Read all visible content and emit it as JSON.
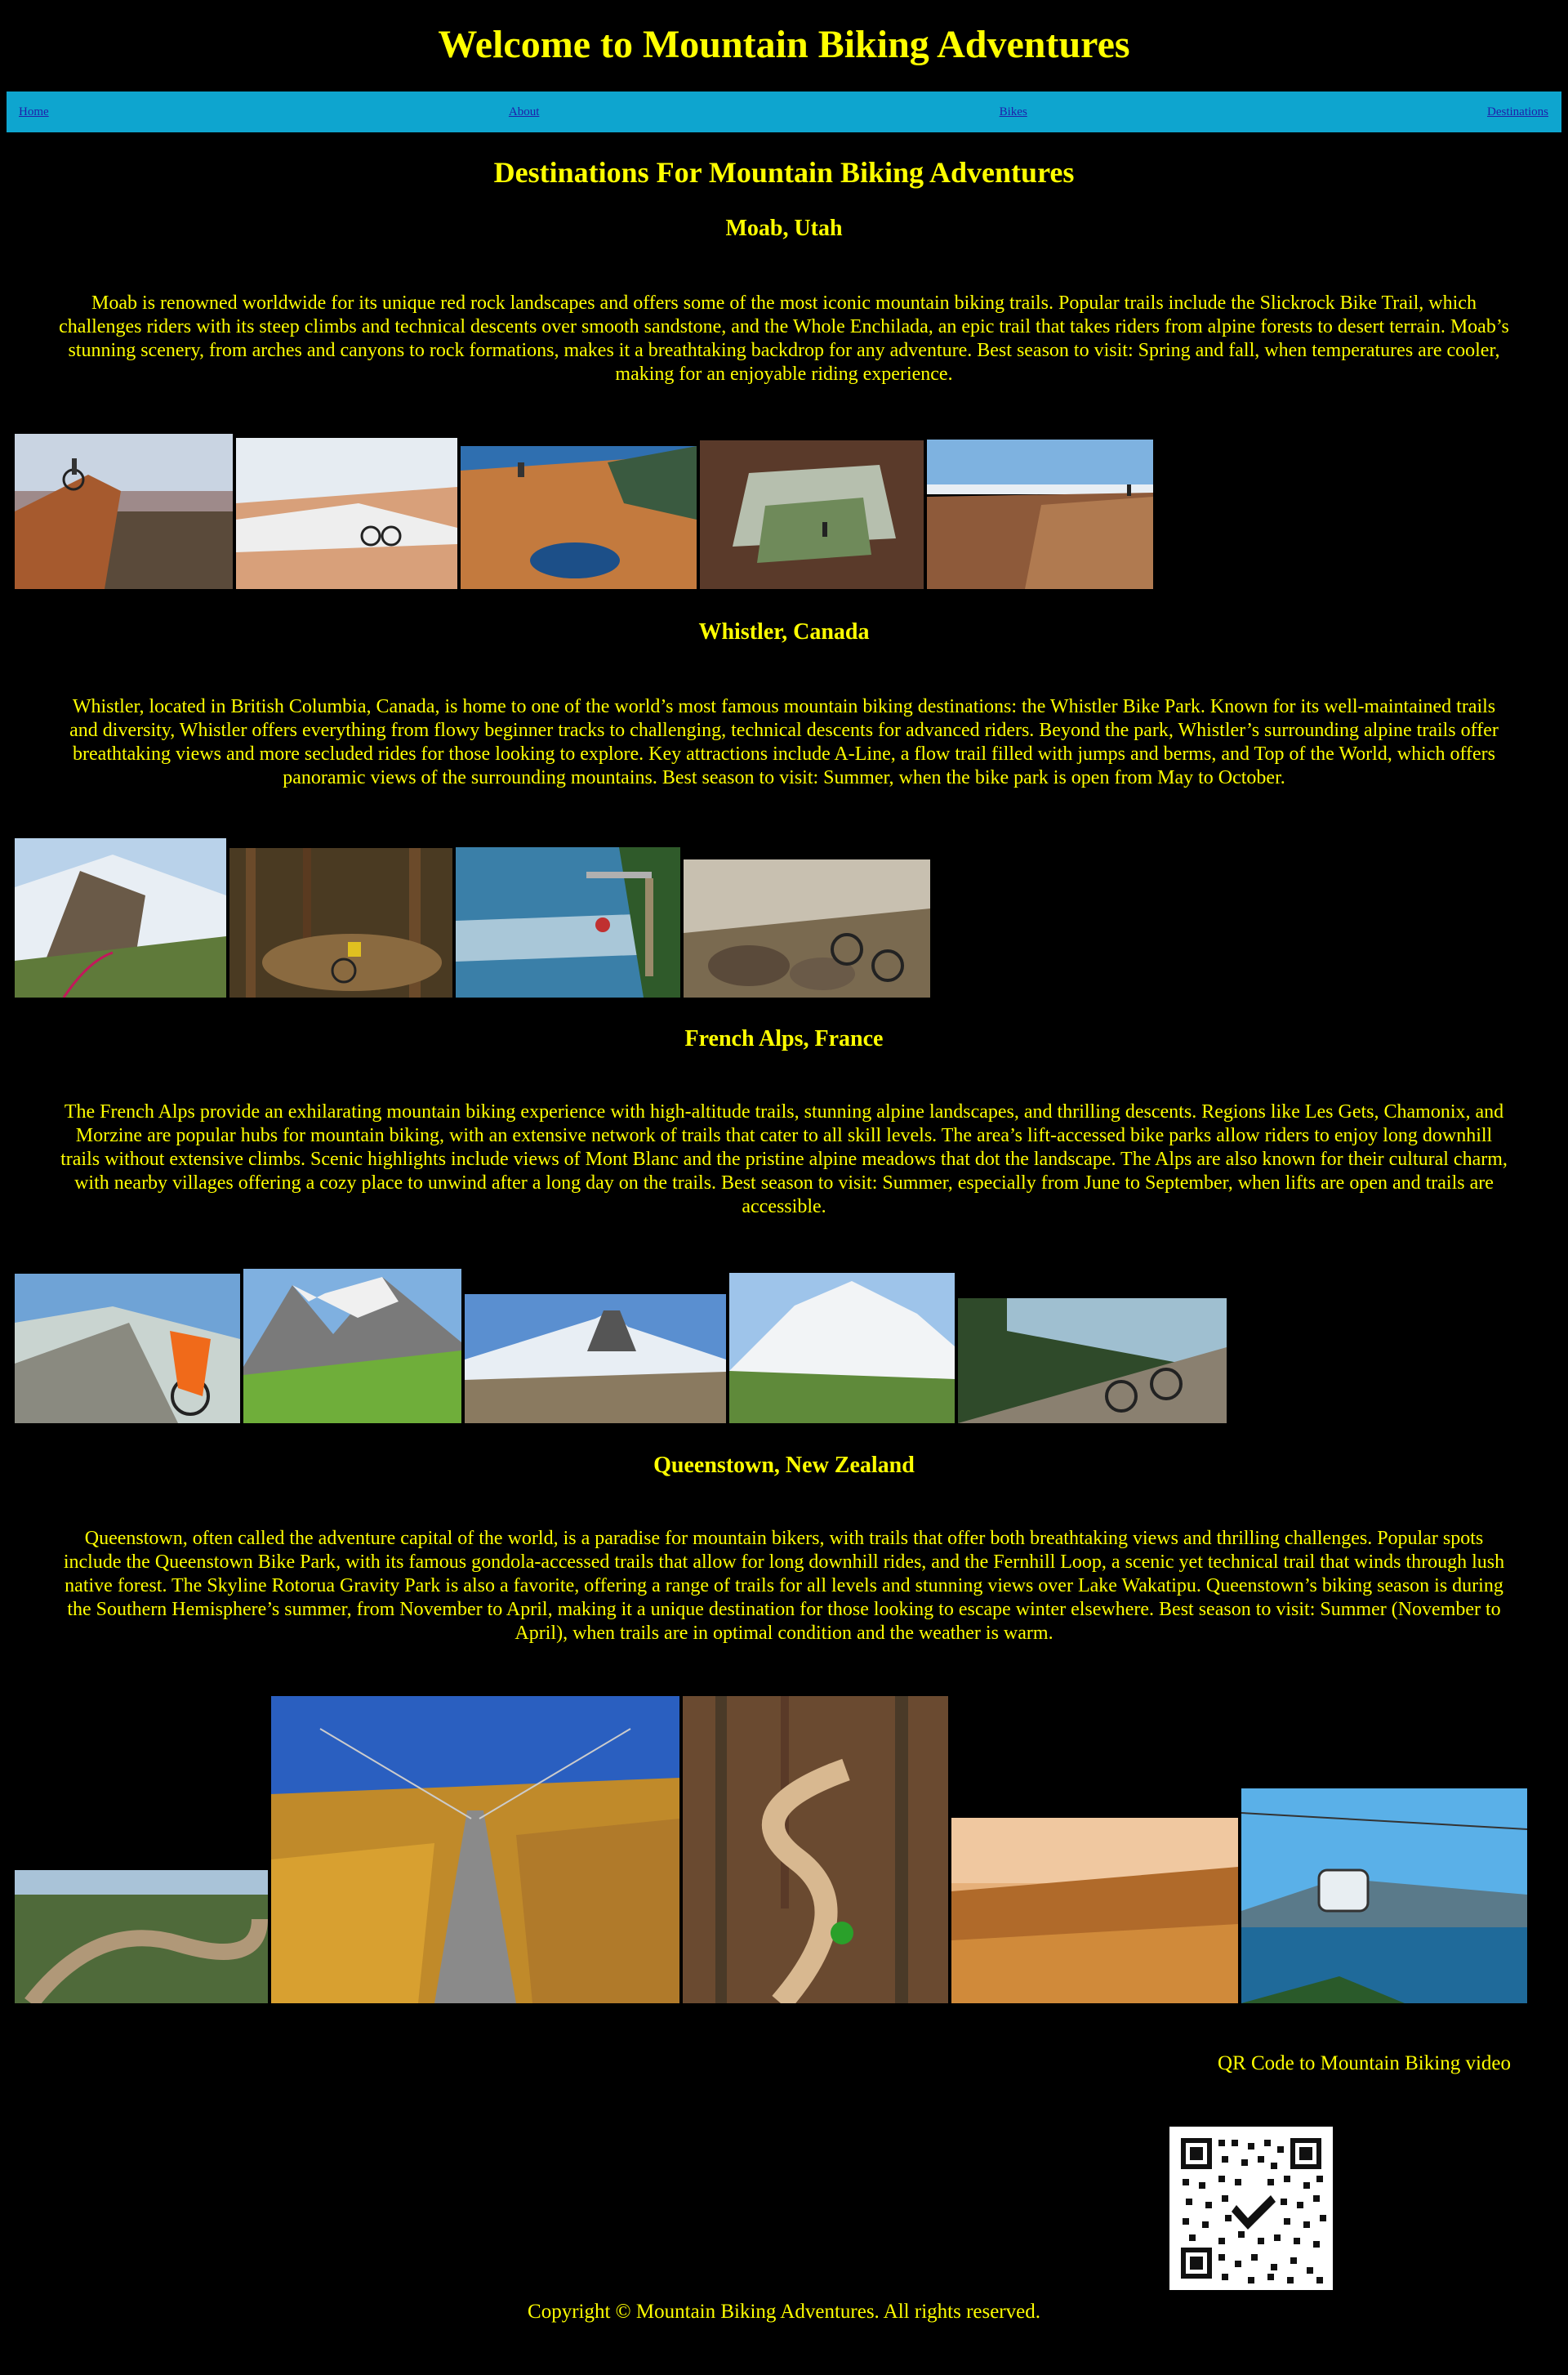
{
  "header": {
    "title": "Welcome to Mountain Biking Adventures"
  },
  "nav": {
    "items": [
      "Home",
      "About",
      "Bikes",
      "Destinations"
    ]
  },
  "main": {
    "heading": "Destinations For Mountain Biking Adventures",
    "sections": [
      {
        "title": "Moab, Utah",
        "text": "Moab is renowned worldwide for its unique red rock landscapes and offers some of the most iconic mountain biking trails. Popular trails include the Slickrock Bike Trail, which challenges riders with its steep climbs and technical descents over smooth sandstone, and the Whole Enchilada, an epic trail that takes riders from alpine forests to desert terrain. Moab’s stunning scenery, from arches and canyons to rock formations, makes it a breathtaking backdrop for any adventure. Best season to visit: Spring and fall, when temperatures are cooler, making for an enjoyable riding experience."
      },
      {
        "title": "Whistler, Canada",
        "text": "Whistler, located in British Columbia, Canada, is home to one of the world’s most famous mountain biking destinations: the Whistler Bike Park. Known for its well-maintained trails and diversity, Whistler offers everything from flowy beginner tracks to challenging, technical descents for advanced riders. Beyond the park, Whistler’s surrounding alpine trails offer breathtaking views and more secluded rides for those looking to explore. Key attractions include A-Line, a flow trail filled with jumps and berms, and Top of the World, which offers panoramic views of the surrounding mountains. Best season to visit: Summer, when the bike park is open from May to October."
      },
      {
        "title": "French Alps, France",
        "text": "The French Alps provide an exhilarating mountain biking experience with high-altitude trails, stunning alpine landscapes, and thrilling descents. Regions like Les Gets, Chamonix, and Morzine are popular hubs for mountain biking, with an extensive network of trails that cater to all skill levels. The area’s lift-accessed bike parks allow riders to enjoy long downhill trails without extensive climbs. Scenic highlights include views of Mont Blanc and the pristine alpine meadows that dot the landscape. The Alps are also known for their cultural charm, with nearby villages offering a cozy place to unwind after a long day on the trails. Best season to visit: Summer, especially from June to September, when lifts are open and trails are accessible."
      },
      {
        "title": "Queenstown, New Zealand",
        "text": "Queenstown, often called the adventure capital of the world, is a paradise for mountain bikers, with trails that offer both breathtaking views and thrilling challenges. Popular spots include the Queenstown Bike Park, with its famous gondola-accessed trails that allow for long downhill rides, and the Fernhill Loop, a scenic yet technical trail that winds through lush native forest. The Skyline Rotorua Gravity Park is also a favorite, offering a range of trails for all levels and stunning views over Lake Wakatipu. Queenstown’s biking season is during the Southern Hemisphere’s summer, from November to April, making it a unique destination for those looking to escape winter elsewhere. Best season to visit: Summer (November to April), when trails are in optimal condition and the weather is warm."
      }
    ]
  },
  "qr": {
    "label": "QR Code to Mountain Biking video"
  },
  "footer": {
    "text": "Copyright © Mountain Biking Adventures. All rights reserved."
  },
  "colors": {
    "background": "#000000",
    "text": "#ffff00",
    "nav_bar": "#0ea5cf",
    "nav_link": "#1f1faa"
  }
}
